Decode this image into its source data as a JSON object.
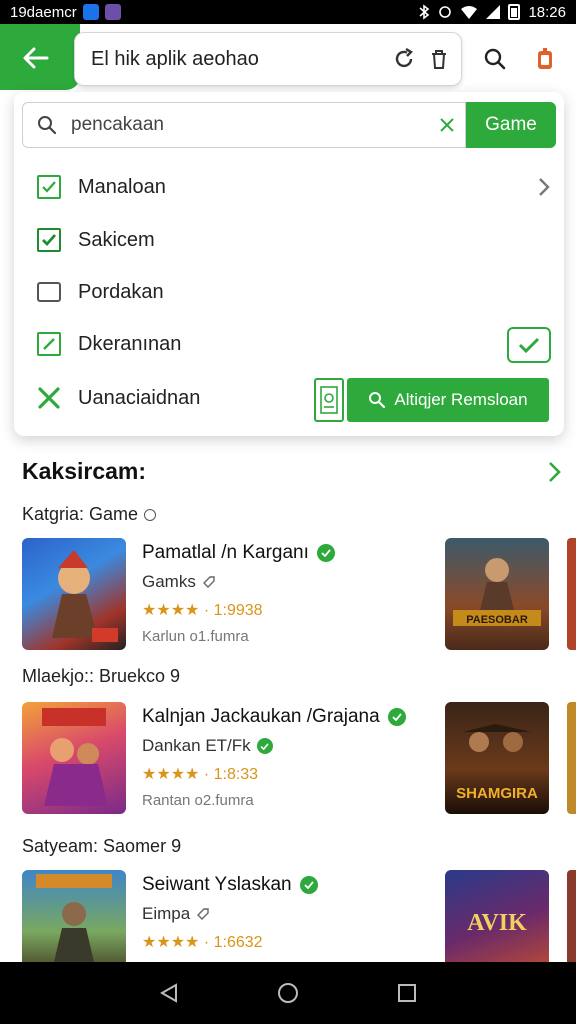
{
  "status_bar": {
    "left_text": "19daemcr",
    "time": "18:26",
    "app_icon_colors": [
      "#1a73e8",
      "#6b4fa8"
    ]
  },
  "url_bar": {
    "text": "El hik aplik aeohao"
  },
  "dropdown": {
    "search_value": "pencakaan",
    "search_button": "Game",
    "items": [
      {
        "label": "Manaloan",
        "icon": "checkbox-checked-icon"
      },
      {
        "label": "Sakicem",
        "icon": "checkbox-filled-icon"
      },
      {
        "label": "Pordakan",
        "icon": "folder-icon"
      },
      {
        "label": "Dkeranınan",
        "icon": "checkbox-edit-icon"
      },
      {
        "label": "Uanaciaidnan",
        "icon": "close-x-icon"
      }
    ],
    "action_button": "Altiqjer Remsloan"
  },
  "content": {
    "section_title": "Kaksircam:",
    "groups": [
      {
        "label": "Katgria: Game",
        "app": {
          "name": "Pamatlal /n Karganı",
          "sub": "Gamks",
          "rating": "★★★★ · 1:9938",
          "meta": "Karlun o1.fumra"
        }
      },
      {
        "label": "Mlaekjo:: Bruekco 9",
        "app": {
          "name": "Kalnjan Jackaukan /Grajana",
          "sub": "Dankan ET/Fk",
          "rating": "★★★★ · 1:8:33",
          "meta": "Rantan o2.fumra"
        }
      },
      {
        "label": "Satyeam: Saomer 9",
        "app": {
          "name": "Seiwant Yslaskan",
          "sub": "Eimpa",
          "rating": "★★★★ · 1:6632",
          "meta": ""
        }
      }
    ],
    "side_thumb_labels": [
      "PAESOBAR",
      "SHAMGIRA",
      "AVIK"
    ]
  },
  "colors": {
    "accent": "#2eaa3c",
    "rating": "#d9951a"
  }
}
